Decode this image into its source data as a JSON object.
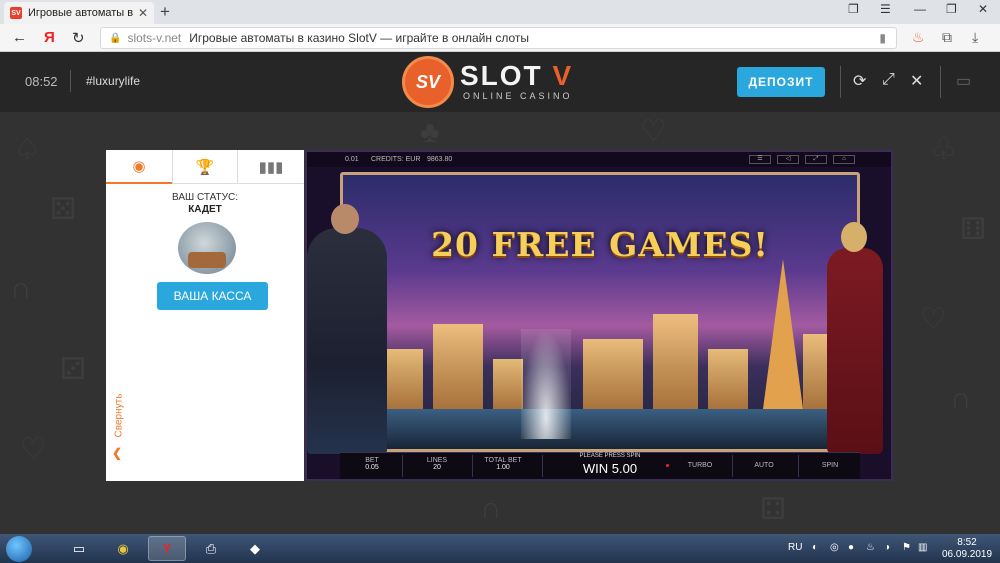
{
  "browser": {
    "tab_title": "Игровые автоматы в ка",
    "favicon_text": "SV",
    "url_domain": "slots-v.net",
    "page_title": "Игровые автоматы в казино SlotV — играйте в онлайн слоты"
  },
  "site": {
    "time": "08:52",
    "hashtag": "#luxurylife",
    "logo_badge": "SV",
    "logo_main": "SLOT",
    "logo_v": "V",
    "logo_sub": "ONLINE CASINO",
    "deposit_label": "ДЕПОЗИТ"
  },
  "panel": {
    "status_label": "ВАШ СТАТУС:",
    "status_value": "КАДЕТ",
    "kassa_label": "ВАША КАССА",
    "collapse_label": "Свернуть"
  },
  "game": {
    "bet_value_top": "0.01",
    "credits_label": "CREDITS: EUR",
    "credits_value": "9863.80",
    "headline": "20 FREE GAMES!",
    "bet_label": "BET",
    "bet_value": "0.05",
    "lines_label": "LINES",
    "lines_value": "20",
    "total_bet_label": "TOTAL BET",
    "total_bet_value": "1.00",
    "prompt": "PLEASE PRESS SPIN",
    "win_text": "WIN 5.00",
    "turbo_label": "TURBO",
    "auto_label": "AUTO",
    "spin_label": "SPIN"
  },
  "taskbar": {
    "lang": "RU",
    "time": "8:52",
    "date": "06.09.2019"
  }
}
